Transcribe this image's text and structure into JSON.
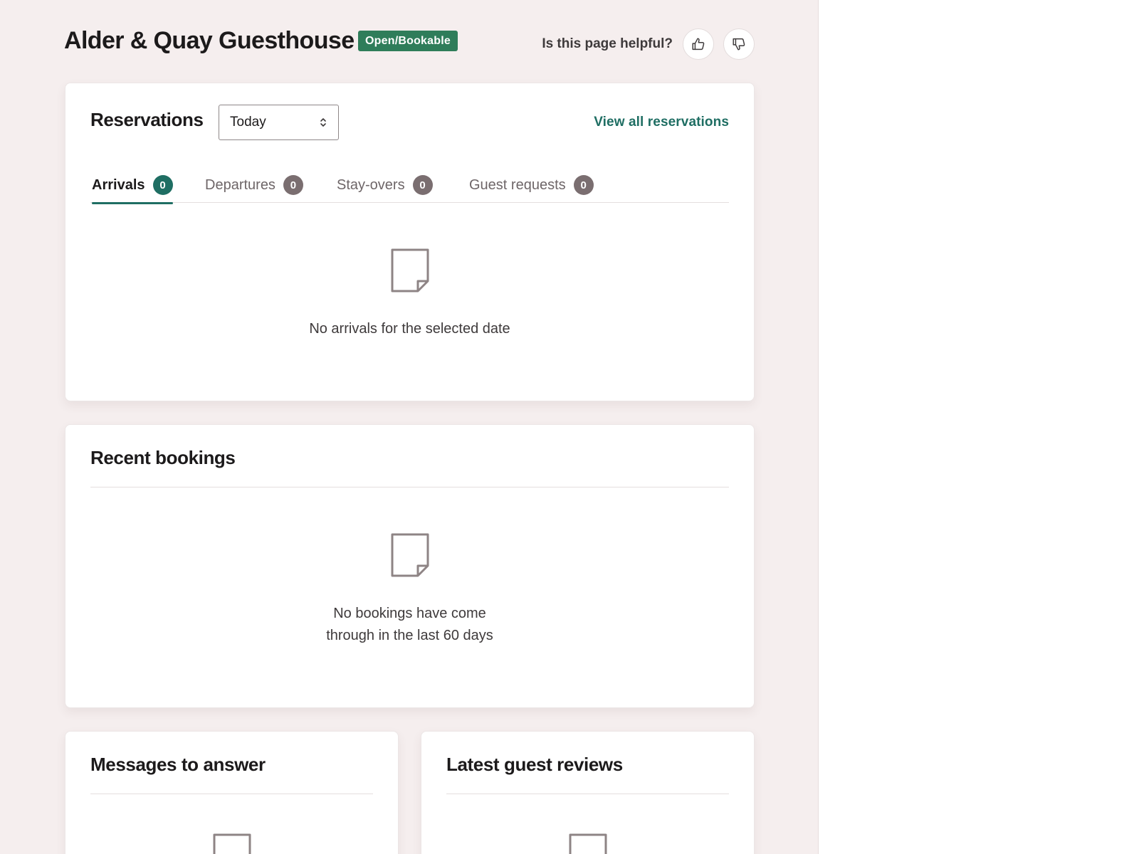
{
  "header": {
    "title": "Alder & Quay Guesthouse",
    "status_badge": "Open/Bookable",
    "helpful_label": "Is this page helpful?"
  },
  "reservations": {
    "title": "Reservations",
    "date_select": {
      "value": "Today"
    },
    "view_all_label": "View all reservations",
    "tabs": [
      {
        "label": "Arrivals",
        "count": "0",
        "active": true
      },
      {
        "label": "Departures",
        "count": "0",
        "active": false
      },
      {
        "label": "Stay-overs",
        "count": "0",
        "active": false
      },
      {
        "label": "Guest requests",
        "count": "0",
        "active": false
      }
    ],
    "empty_message": "No arrivals for the selected date"
  },
  "recent_bookings": {
    "title": "Recent bookings",
    "empty_message_line1": "No bookings have come",
    "empty_message_line2": "through in the last 60 days"
  },
  "messages": {
    "title": "Messages to answer"
  },
  "reviews": {
    "title": "Latest guest reviews"
  },
  "colors": {
    "accent": "#1f6e63",
    "badge_green": "#2f7d5a",
    "page_bg": "#f5eeee",
    "count_badge": "#7a6e70"
  },
  "icons": {
    "thumbs_up": "thumbs-up-icon",
    "thumbs_down": "thumbs-down-icon",
    "select_chevrons": "chevron-updown-icon",
    "empty_document": "document-icon"
  }
}
